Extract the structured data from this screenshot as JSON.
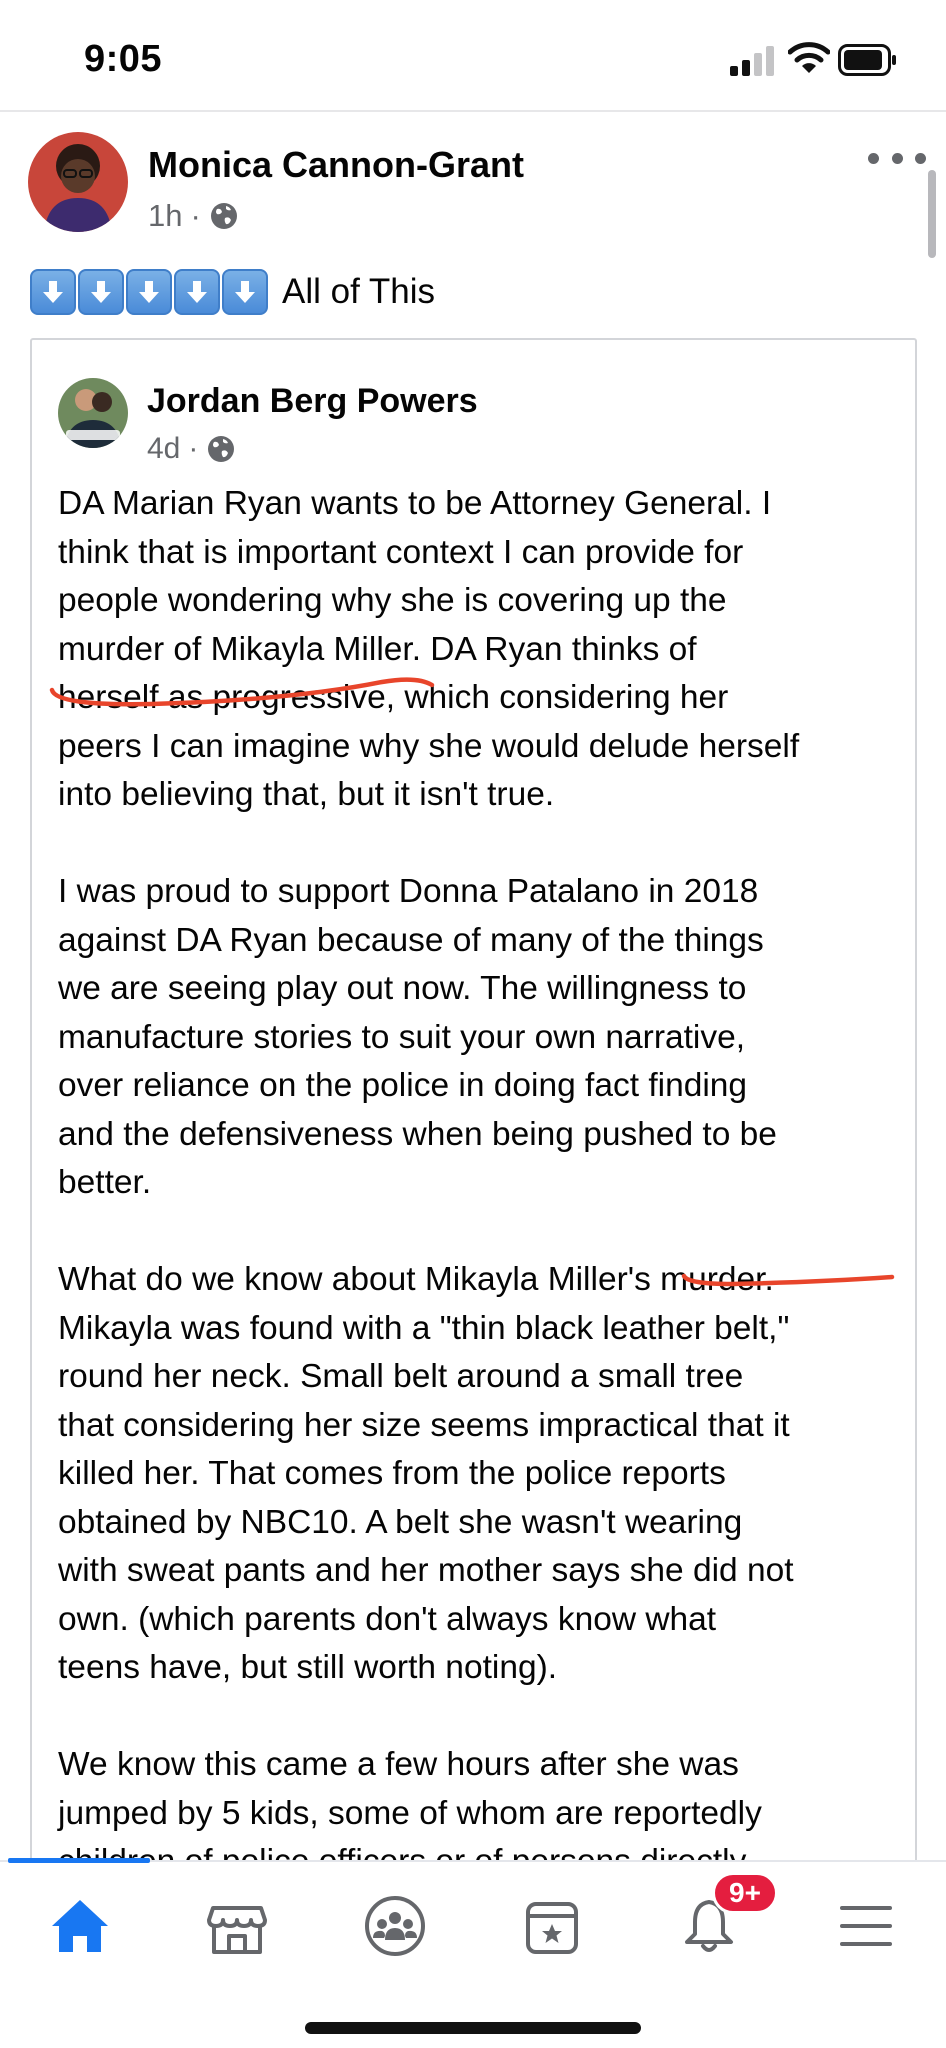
{
  "status_bar": {
    "time": "9:05"
  },
  "post": {
    "author": "Monica Cannon-Grant",
    "time": "1h",
    "separator": "·",
    "message_emoji": [
      "arrow-down-emoji",
      "arrow-down-emoji",
      "arrow-down-emoji",
      "arrow-down-emoji",
      "arrow-down-emoji"
    ],
    "message_text": "All of This",
    "shared": {
      "author": "Jordan Berg Powers",
      "time": "4d",
      "paragraphs": [
        [
          "DA Marian Ryan wants to be Attorney General. I",
          "think that is important context I can provide for",
          "people wondering why she is covering up the",
          "murder of Mikayla Miller. DA Ryan thinks of",
          "herself as progressive, which considering her",
          "peers I can imagine why she would delude herself",
          "into believing that, but it isn't true."
        ],
        [
          "I was proud to support Donna Patalano in 2018",
          "against DA Ryan because of many of the things",
          "we are seeing play out now. The willingness to",
          "manufacture stories to suit your own narrative,",
          "over reliance on the police in doing fact finding",
          "and the defensiveness when being pushed to be",
          "better."
        ],
        [
          "What do we know about Mikayla Miller's murder.",
          "Mikayla was found with a \"thin black leather belt,\"",
          "round her neck. Small belt around a small tree",
          "that considering her size seems impractical that it",
          "killed her. That comes from the police reports",
          "obtained by NBC10. A belt she wasn't wearing",
          "with sweat pants and her mother says she did not",
          "own. (which parents don't always know what",
          "teens have, but still worth noting)."
        ],
        [
          "We know this came a few hours after she was",
          "jumped by 5 kids, some of whom are reportedly",
          "children of police officers or of persons directly"
        ]
      ]
    }
  },
  "tab_bar": {
    "tabs": [
      "home-icon",
      "marketplace-icon",
      "groups-icon",
      "events-icon",
      "notifications-icon",
      "menu-icon"
    ],
    "notifications_badge": "9+"
  },
  "colors": {
    "accent": "#1877f2",
    "annotation": "#e8452b",
    "badge": "#e41e3f",
    "meta": "#65676b"
  }
}
